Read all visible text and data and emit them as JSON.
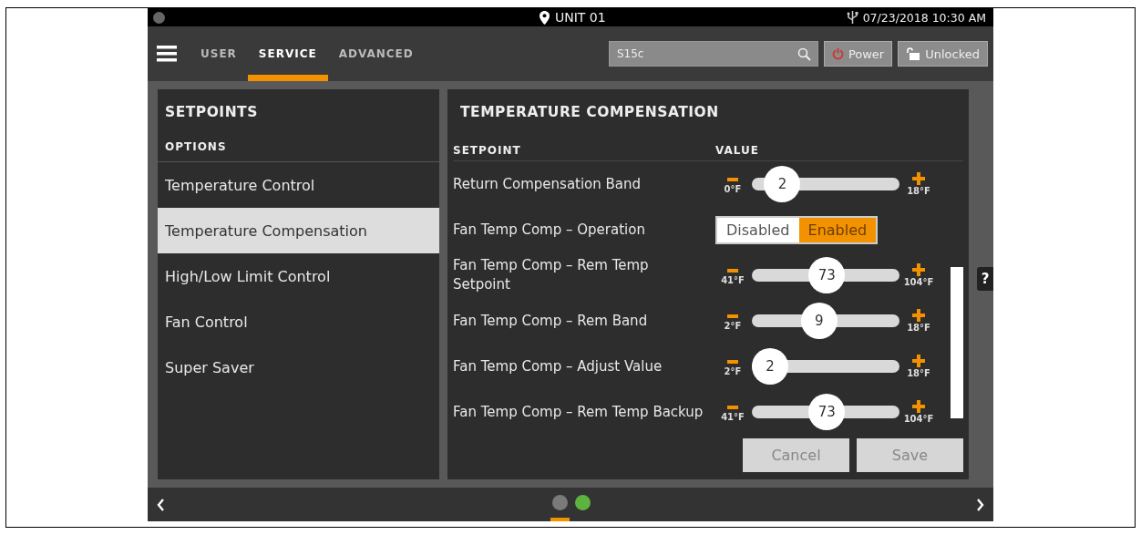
{
  "status_bar": {
    "unit": "UNIT 01",
    "datetime": "07/23/2018 10:30 AM"
  },
  "tabs": [
    {
      "label": "USER",
      "selected": false
    },
    {
      "label": "SERVICE",
      "selected": true
    },
    {
      "label": "ADVANCED",
      "selected": false
    }
  ],
  "search": {
    "value": "S15c"
  },
  "buttons": [
    {
      "label": "Power",
      "kind": "power"
    },
    {
      "label": "Unlocked",
      "kind": "lock"
    }
  ],
  "sidebar": {
    "title": "SETPOINTS",
    "heading": "OPTIONS",
    "items": [
      {
        "label": "Temperature Control",
        "selected": false
      },
      {
        "label": "Temperature Compensation",
        "selected": true
      },
      {
        "label": "High/Low Limit Control",
        "selected": false
      },
      {
        "label": "Fan Control",
        "selected": false
      },
      {
        "label": "Super Saver",
        "selected": false
      }
    ]
  },
  "panel": {
    "title": "TEMPERATURE COMPENSATION",
    "columns": [
      "SETPOINT",
      "VALUE"
    ],
    "rows": [
      {
        "kind": "slider",
        "label": "Return Compensation Band",
        "value": "2",
        "min": "0°F",
        "max": "18°F",
        "level": 0.11
      },
      {
        "kind": "toggle",
        "label": "Fan Temp Comp – Operation",
        "options": [
          {
            "label": "Disabled",
            "selected": false
          },
          {
            "label": "Enabled",
            "selected": true
          }
        ]
      },
      {
        "kind": "slider",
        "label": "Fan Temp Comp – Rem Temp Setpoint",
        "value": "73",
        "min": "41°F",
        "max": "104°F",
        "level": 0.51
      },
      {
        "kind": "slider",
        "label": "Fan Temp Comp – Rem Band",
        "value": "9",
        "min": "2°F",
        "max": "18°F",
        "level": 0.44
      },
      {
        "kind": "slider",
        "label": "Fan Temp Comp – Adjust Value",
        "value": "2",
        "min": "2°F",
        "max": "18°F",
        "level": 0
      },
      {
        "kind": "slider",
        "label": "Fan Temp Comp – Rem Temp Backup",
        "value": "73",
        "min": "41°F",
        "max": "104°F",
        "level": 0.51
      }
    ],
    "actions": [
      "Cancel",
      "Save"
    ]
  },
  "help": "?",
  "pager": {
    "pages": [
      {
        "selected": true,
        "color": "#7a7a7a"
      },
      {
        "selected": false,
        "color": "#5cb33f"
      }
    ]
  }
}
